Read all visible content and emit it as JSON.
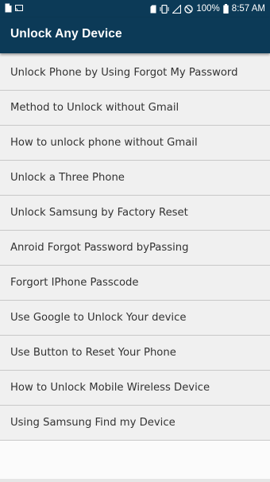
{
  "status_bar": {
    "left_icons": [
      "document-icon",
      "cast-icon"
    ],
    "battery_percent": "100%",
    "time": "8:57 AM"
  },
  "app_bar": {
    "title": "Unlock Any Device"
  },
  "list": {
    "items": [
      {
        "label": "Unlock Phone by Using Forgot My Password"
      },
      {
        "label": "Method to Unlock without Gmail"
      },
      {
        "label": "How to unlock phone without Gmail"
      },
      {
        "label": "Unlock a Three Phone"
      },
      {
        "label": "Unlock Samsung by Factory Reset"
      },
      {
        "label": "Anroid Forgot Password byPassing"
      },
      {
        "label": "Forgort IPhone Passcode"
      },
      {
        "label": "Use Google to Unlock Your device"
      },
      {
        "label": "Use Button to Reset Your Phone"
      },
      {
        "label": "How to Unlock Mobile Wireless Device"
      },
      {
        "label": "Using Samsung Find my Device"
      }
    ]
  },
  "colors": {
    "primary": "#0c3a57",
    "list_background": "#f0f0f0",
    "divider": "#c8c8c8",
    "text": "#333333"
  }
}
